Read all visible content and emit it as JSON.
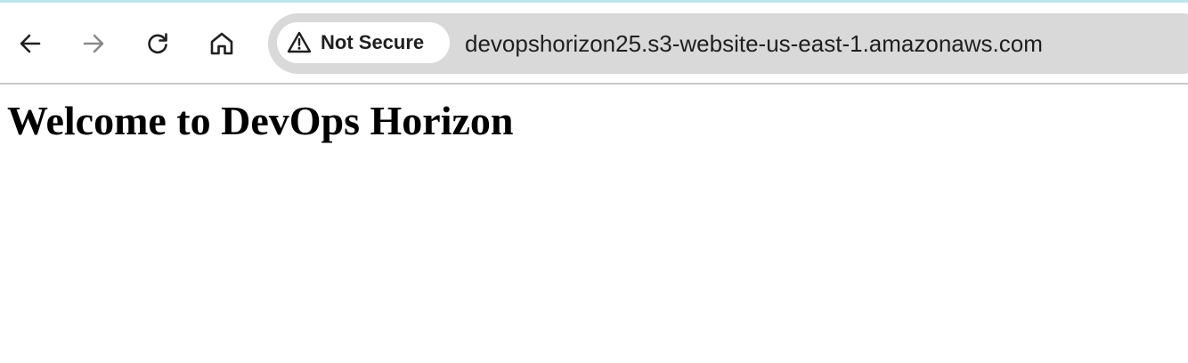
{
  "browser": {
    "nav": {
      "back_icon": "arrow-left-icon",
      "forward_icon": "arrow-right-icon",
      "reload_icon": "reload-icon",
      "home_icon": "home-icon"
    },
    "address_bar": {
      "security_icon": "warning-triangle-icon",
      "security_label": "Not Secure",
      "url": "devopshorizon25.s3-website-us-east-1.amazonaws.com"
    },
    "colors": {
      "accent_line": "#bfe6ee",
      "omnibox_bg": "#d9d9d9",
      "icon_active": "#1f1f1f",
      "icon_disabled": "#8a8a8a"
    }
  },
  "page": {
    "heading": "Welcome to DevOps Horizon"
  }
}
